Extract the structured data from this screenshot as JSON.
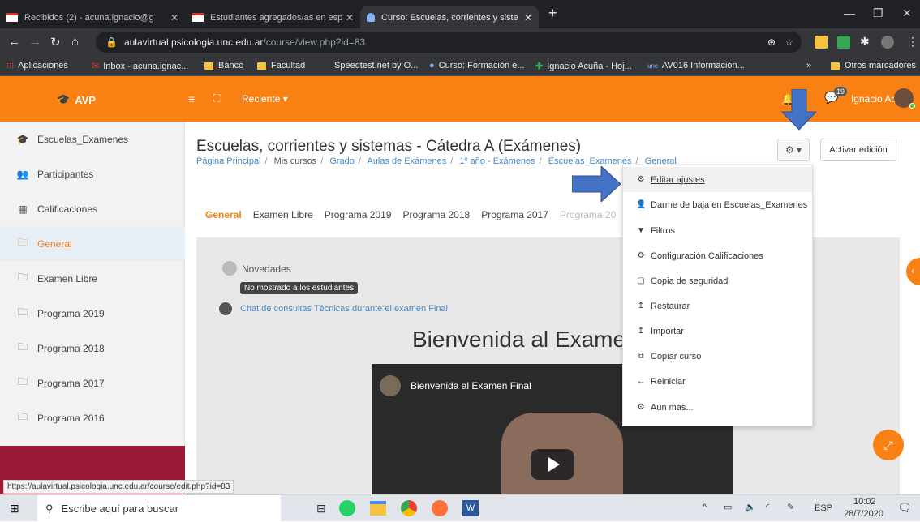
{
  "browser": {
    "tabs": [
      {
        "label": "Recibidos (2) - acuna.ignacio@g",
        "icon": "gmail-icon"
      },
      {
        "label": "Estudiantes agregados/as en esp",
        "icon": "gmail-icon"
      },
      {
        "label": "Curso: Escuelas, corrientes y siste",
        "icon": "moodle-icon"
      }
    ],
    "url_host": "aulavirtual.psicologia.unc.edu.ar",
    "url_path": "/course/view.php?id=83",
    "bookmarks": [
      "Aplicaciones",
      "Inbox - acuna.ignac...",
      "Banco",
      "Facultad",
      "Speedtest.net by O...",
      "Curso: Formación e...",
      "Ignacio Acuña - Hoj...",
      "AV016 Información...",
      "»",
      "Otros marcadores"
    ]
  },
  "navbar": {
    "brand": "AVP",
    "recent": "Reciente ▾",
    "messages_badge": "19",
    "user": "Ignacio Acuña"
  },
  "sidebar": {
    "items": [
      {
        "label": "Escuelas_Examenes",
        "icon": "graduation-cap-icon"
      },
      {
        "label": "Participantes",
        "icon": "users-icon"
      },
      {
        "label": "Calificaciones",
        "icon": "table-icon"
      },
      {
        "label": "General",
        "icon": "folder-icon"
      },
      {
        "label": "Examen Libre",
        "icon": "folder-icon"
      },
      {
        "label": "Programa 2019",
        "icon": "folder-icon"
      },
      {
        "label": "Programa 2018",
        "icon": "folder-icon"
      },
      {
        "label": "Programa 2017",
        "icon": "folder-icon"
      },
      {
        "label": "Programa 2016",
        "icon": "folder-icon"
      }
    ]
  },
  "page": {
    "title": "Escuelas, corrientes y sistemas - Cátedra A (Exámenes)",
    "breadcrumbs": [
      "Página Principal",
      "Mis cursos",
      "Grado",
      "Aulas de Exámenes",
      "1º año - Exámenes",
      "Escuelas_Examenes",
      "General"
    ],
    "gear_label": "⚙ ▾",
    "edit_button": "Activar edición",
    "tabs": [
      "General",
      "Examen Libre",
      "Programa 2019",
      "Programa 2018",
      "Programa 2017",
      "Programa 20"
    ],
    "news": "Novedades",
    "hidden_badge": "No mostrado a los estudiantes",
    "chat_link": "Chat de consultas Técnicas durante el examen Final",
    "welcome": "Bienvenida al Exame",
    "video_title": "Bienvenida al Examen Final"
  },
  "menu": {
    "items": [
      {
        "label": "Editar ajustes",
        "icon": "⚙"
      },
      {
        "label": "Darme de baja en Escuelas_Examenes",
        "icon": "👤"
      },
      {
        "label": "Filtros",
        "icon": "▼"
      },
      {
        "label": "Configuración Calificaciones",
        "icon": "⚙"
      },
      {
        "label": "Copia de seguridad",
        "icon": "▢"
      },
      {
        "label": "Restaurar",
        "icon": "↥"
      },
      {
        "label": "Importar",
        "icon": "↥"
      },
      {
        "label": "Copiar curso",
        "icon": "⧉"
      },
      {
        "label": "Reiniciar",
        "icon": "←"
      },
      {
        "label": "Aún más...",
        "icon": "⚙"
      }
    ]
  },
  "status_url": "https://aulavirtual.psicologia.unc.edu.ar/course/edit.php?id=83",
  "taskbar": {
    "search": "Escribe aquí para buscar",
    "lang": "ESP",
    "time": "10:02",
    "date": "28/7/2020"
  },
  "colors": {
    "accent": "#f98012",
    "sidebar_footer": "#9b1b37",
    "link": "#4a8bc4",
    "arrow": "#4472c4"
  }
}
